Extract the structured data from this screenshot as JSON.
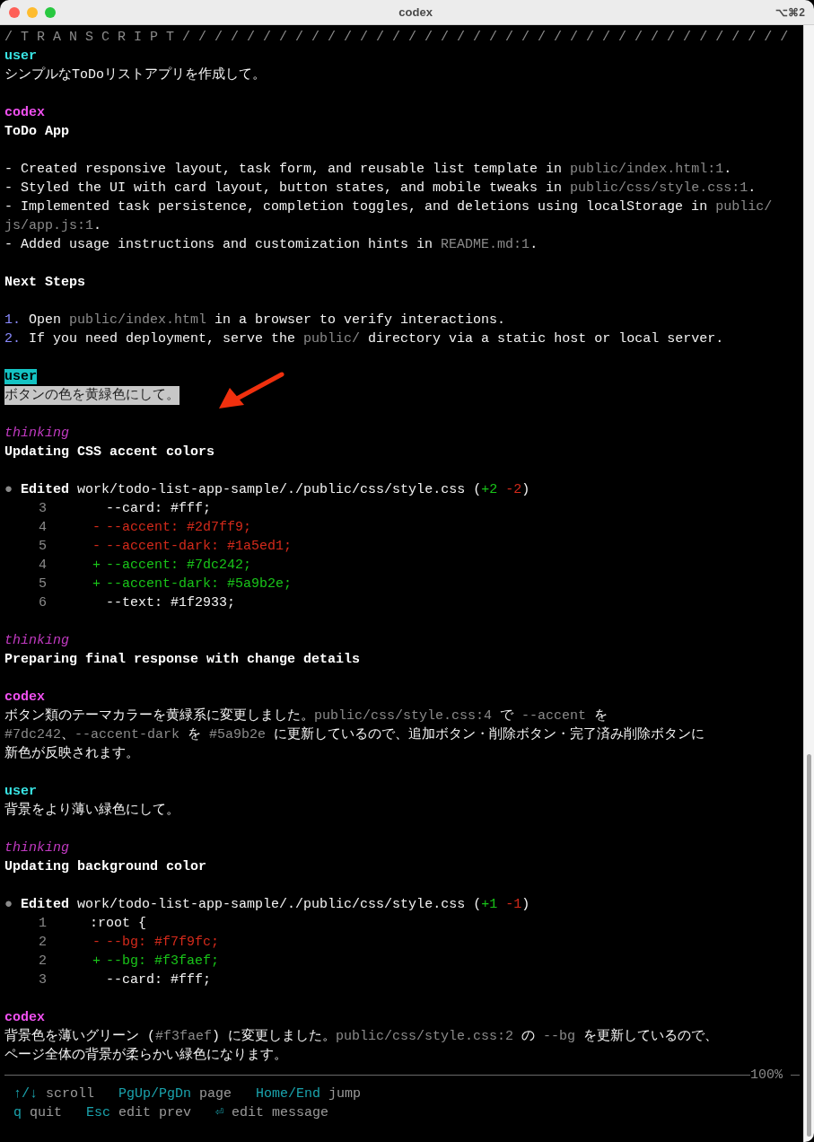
{
  "window": {
    "title": "codex",
    "shortcut": "⌥⌘2"
  },
  "transcript": {
    "header": "/ T R A N S C R I P T / / / / / / / / / / / / / / / / / / / / / / / / / / / / / / / / / / / / / /",
    "messages": [
      {
        "kind": "user",
        "label": "user",
        "selected": false,
        "lines": [
          {
            "kind": "text",
            "segments": [
              {
                "text": "シンプルなToDoリストアプリを作成して。",
                "kind": "plain"
              }
            ]
          }
        ]
      },
      {
        "kind": "codex",
        "label": "codex",
        "selected": false,
        "lines": [
          {
            "kind": "text",
            "segments": [
              {
                "text": "ToDo App",
                "kind": "bold"
              }
            ]
          },
          {
            "kind": "blank"
          },
          {
            "kind": "text",
            "segments": [
              {
                "text": "- Created responsive layout, task form, and reusable list template in ",
                "kind": "plain"
              },
              {
                "text": "public/index.html:1",
                "kind": "dim"
              },
              {
                "text": ".",
                "kind": "plain"
              }
            ]
          },
          {
            "kind": "text",
            "segments": [
              {
                "text": "- Styled the UI with card layout, button states, and mobile tweaks in ",
                "kind": "plain"
              },
              {
                "text": "public/css/style.css:1",
                "kind": "dim"
              },
              {
                "text": ".",
                "kind": "plain"
              }
            ]
          },
          {
            "kind": "text",
            "segments": [
              {
                "text": "- Implemented task persistence, completion toggles, and deletions using localStorage in ",
                "kind": "plain"
              },
              {
                "text": "public/",
                "kind": "dim"
              }
            ]
          },
          {
            "kind": "text",
            "segments": [
              {
                "text": "js/app.js:1",
                "kind": "dim"
              },
              {
                "text": ".",
                "kind": "plain"
              }
            ]
          },
          {
            "kind": "text",
            "segments": [
              {
                "text": "- Added usage instructions and customization hints in ",
                "kind": "plain"
              },
              {
                "text": "README.md:1",
                "kind": "dim"
              },
              {
                "text": ".",
                "kind": "plain"
              }
            ]
          },
          {
            "kind": "blank"
          },
          {
            "kind": "text",
            "segments": [
              {
                "text": "Next Steps",
                "kind": "bold"
              }
            ]
          },
          {
            "kind": "blank"
          },
          {
            "kind": "text",
            "segments": [
              {
                "text": "1.",
                "kind": "num"
              },
              {
                "text": " Open ",
                "kind": "plain"
              },
              {
                "text": "public/index.html",
                "kind": "dim"
              },
              {
                "text": " in a browser to verify interactions.",
                "kind": "plain"
              }
            ]
          },
          {
            "kind": "text",
            "segments": [
              {
                "text": "2.",
                "kind": "num"
              },
              {
                "text": " If you need deployment, serve the ",
                "kind": "plain"
              },
              {
                "text": "public/",
                "kind": "dim"
              },
              {
                "text": " directory via a static host or local server.",
                "kind": "plain"
              }
            ]
          }
        ]
      },
      {
        "kind": "user",
        "label": "user",
        "selected": true,
        "lines": [
          {
            "kind": "text",
            "segments": [
              {
                "text": "ボタンの色を黄緑色にして。",
                "kind": "plain"
              }
            ]
          }
        ]
      },
      {
        "kind": "thinking",
        "label": "thinking",
        "selected": false,
        "lines": [
          {
            "kind": "text",
            "segments": [
              {
                "text": "Updating CSS accent colors",
                "kind": "bold"
              }
            ]
          }
        ]
      },
      {
        "kind": "edit",
        "bullet": "●",
        "verb": "Edited",
        "path": "work/todo-list-app-sample/./public/css/style.css",
        "stats": [
          {
            "text": "(",
            "kind": "plain"
          },
          {
            "text": "+2",
            "kind": "add"
          },
          {
            "text": " -2",
            "kind": "del"
          },
          {
            "text": ")",
            "kind": "plain"
          }
        ],
        "rows": [
          {
            "num": "3",
            "sign": "",
            "code": "--card: #fff;",
            "kind": "context"
          },
          {
            "num": "4",
            "sign": "-",
            "code": "--accent: #2d7ff9;",
            "kind": "del"
          },
          {
            "num": "5",
            "sign": "-",
            "code": "--accent-dark: #1a5ed1;",
            "kind": "del"
          },
          {
            "num": "4",
            "sign": "+",
            "code": "--accent: #7dc242;",
            "kind": "add"
          },
          {
            "num": "5",
            "sign": "+",
            "code": "--accent-dark: #5a9b2e;",
            "kind": "add"
          },
          {
            "num": "6",
            "sign": "",
            "code": "--text: #1f2933;",
            "kind": "context"
          }
        ]
      },
      {
        "kind": "thinking",
        "label": "thinking",
        "selected": false,
        "lines": [
          {
            "kind": "text",
            "segments": [
              {
                "text": "Preparing final response with change details",
                "kind": "bold"
              }
            ]
          }
        ]
      },
      {
        "kind": "codex",
        "label": "codex",
        "selected": false,
        "lines": [
          {
            "kind": "text",
            "segments": [
              {
                "text": "ボタン類のテーマカラーを黄緑系に変更しました。",
                "kind": "plain"
              },
              {
                "text": "public/css/style.css:4",
                "kind": "dim"
              },
              {
                "text": " で ",
                "kind": "plain"
              },
              {
                "text": "--accent",
                "kind": "dim"
              },
              {
                "text": " を",
                "kind": "plain"
              }
            ]
          },
          {
            "kind": "text",
            "segments": [
              {
                "text": "#7dc242",
                "kind": "dim"
              },
              {
                "text": "、",
                "kind": "plain"
              },
              {
                "text": "--accent-dark",
                "kind": "dim"
              },
              {
                "text": " を ",
                "kind": "plain"
              },
              {
                "text": "#5a9b2e",
                "kind": "dim"
              },
              {
                "text": " に更新しているので、追加ボタン・削除ボタン・完了済み削除ボタンに",
                "kind": "plain"
              }
            ]
          },
          {
            "kind": "text",
            "segments": [
              {
                "text": "新色が反映されます。",
                "kind": "plain"
              }
            ]
          }
        ]
      },
      {
        "kind": "user",
        "label": "user",
        "selected": false,
        "lines": [
          {
            "kind": "text",
            "segments": [
              {
                "text": "背景をより薄い緑色にして。",
                "kind": "plain"
              }
            ]
          }
        ]
      },
      {
        "kind": "thinking",
        "label": "thinking",
        "selected": false,
        "lines": [
          {
            "kind": "text",
            "segments": [
              {
                "text": "Updating background color",
                "kind": "bold"
              }
            ]
          }
        ]
      },
      {
        "kind": "edit",
        "bullet": "●",
        "verb": "Edited",
        "path": "work/todo-list-app-sample/./public/css/style.css",
        "stats": [
          {
            "text": "(",
            "kind": "plain"
          },
          {
            "text": "+1",
            "kind": "add"
          },
          {
            "text": " -1",
            "kind": "del"
          },
          {
            "text": ")",
            "kind": "plain"
          }
        ],
        "rows": [
          {
            "num": "1",
            "sign": "",
            "code": ":root {",
            "kind": "context"
          },
          {
            "num": "2",
            "sign": "-",
            "code": "--bg: #f7f9fc;",
            "kind": "del"
          },
          {
            "num": "2",
            "sign": "+",
            "code": "--bg: #f3faef;",
            "kind": "add"
          },
          {
            "num": "3",
            "sign": "",
            "code": "--card: #fff;",
            "kind": "context"
          }
        ]
      },
      {
        "kind": "codex",
        "label": "codex",
        "selected": false,
        "lines": [
          {
            "kind": "text",
            "segments": [
              {
                "text": "背景色を薄いグリーン (",
                "kind": "plain"
              },
              {
                "text": "#f3faef",
                "kind": "dim"
              },
              {
                "text": ") に変更しました。",
                "kind": "plain"
              },
              {
                "text": "public/css/style.css:2",
                "kind": "dim"
              },
              {
                "text": " の ",
                "kind": "plain"
              },
              {
                "text": "--bg",
                "kind": "dim"
              },
              {
                "text": " を更新しているので、",
                "kind": "plain"
              }
            ]
          },
          {
            "kind": "text",
            "segments": [
              {
                "text": "ページ全体の背景が柔らかい緑色になります。",
                "kind": "plain"
              }
            ]
          }
        ]
      }
    ]
  },
  "status": {
    "percent": "100%"
  },
  "hints": [
    [
      {
        "key": "↑/↓",
        "action": "scroll"
      },
      {
        "key": "PgUp/PgDn",
        "action": "page"
      },
      {
        "key": "Home/End",
        "action": "jump"
      }
    ],
    [
      {
        "key": "q",
        "action": "quit"
      },
      {
        "key": "Esc",
        "action": "edit prev"
      },
      {
        "key": "⏎",
        "action": "edit message"
      }
    ]
  ]
}
